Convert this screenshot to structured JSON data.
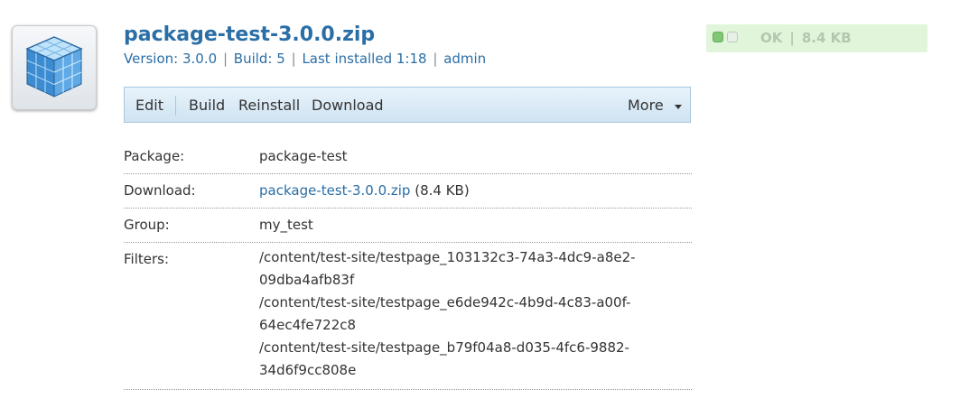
{
  "icon": "package-cube-icon",
  "package": {
    "title": "package-test-3.0.0.zip",
    "version_text": "Version: 3.0.0",
    "build_text": "Build: 5",
    "installed_text": "Last installed 1:18",
    "user": "admin",
    "separator": "|"
  },
  "status": {
    "state": "OK",
    "separator": "|",
    "size": "8.4 KB",
    "indicator_colors": [
      "#7fc772",
      "#e9f1e7"
    ]
  },
  "toolbar": {
    "edit": "Edit",
    "build": "Build",
    "reinstall": "Reinstall",
    "download": "Download",
    "more": "More"
  },
  "details": {
    "package_label": "Package:",
    "package_value": "package-test",
    "download_label": "Download:",
    "download_link": "package-test-3.0.0.zip",
    "download_size": "(8.4 KB)",
    "group_label": "Group:",
    "group_value": "my_test",
    "filters_label": "Filters:",
    "filters": [
      "/content/test-site/testpage_103132c3-74a3-4dc9-a8e2-",
      "09dba4afb83f",
      "/content/test-site/testpage_e6de942c-4b9d-4c83-a00f-",
      "64ec4fe722c8",
      "/content/test-site/testpage_b79f04a8-d035-4fc6-9882-",
      "34d6f9cc808e"
    ]
  },
  "colors": {
    "link": "#2a6ea6",
    "status_bg": "#e0f5da",
    "toolbar_bg": "#cfe3f2"
  }
}
